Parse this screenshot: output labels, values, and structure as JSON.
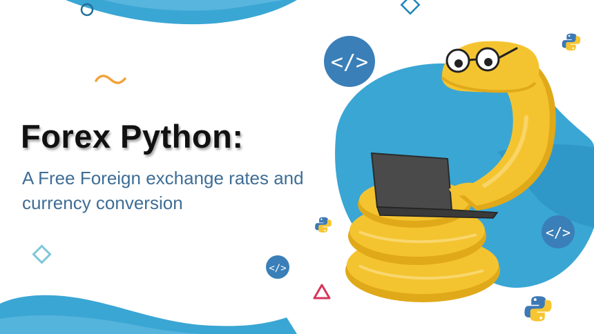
{
  "title": "Forex Python:",
  "subtitle_line1": "A Free Foreign exchange rates and",
  "subtitle_line2": "currency conversion",
  "colors": {
    "primary_blue": "#3aa6d4",
    "dark_blue": "#1c84b8",
    "snake_yellow": "#f4c430",
    "title_text": "#111111",
    "subtitle_text": "#3e6d96",
    "accent_orange": "#f2a33a",
    "accent_red": "#d6355a",
    "accent_teal": "#7ec7d8"
  },
  "icons": [
    "code-badge-icon",
    "python-logo-icon",
    "laptop-icon",
    "diamond-outline-icon",
    "triangle-outline-icon",
    "circle-outline-icon",
    "tilde-icon",
    "glasses-icon"
  ]
}
